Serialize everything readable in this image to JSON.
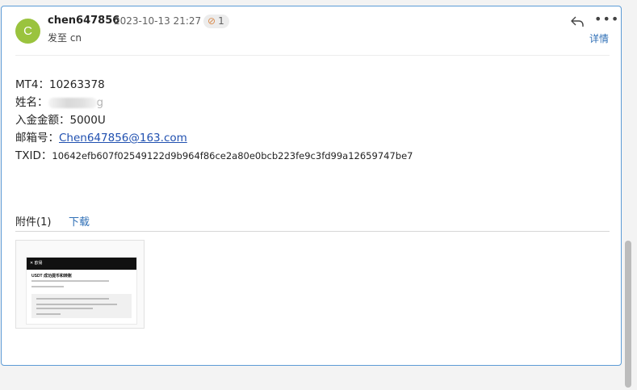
{
  "message": {
    "sender_initial": "C",
    "sender": "chen647856",
    "datetime": "2023-10-13 21:27",
    "attachment_count": "1",
    "to_line": "发至 cn",
    "details_label": "详情",
    "more_label": "•••"
  },
  "body": {
    "mt4_label": "MT4：",
    "mt4_value": "10263378",
    "name_label": "姓名：",
    "name_tail": "g",
    "deposit_label": "入金金额：",
    "deposit_value": "5000U",
    "email_label": "邮箱号：",
    "email_value": "Chen647856@163.com",
    "txid_label": "TXID：",
    "txid_value": "10642efb607f02549122d9b964f86ce2a80e0bcb223fe9c3fd99a12659747be7"
  },
  "attachments": {
    "header": "附件(1)",
    "download_label": "下载",
    "thumbnail": {
      "logo": "✕ 欧易",
      "title": "USDT 成功提币和转账"
    }
  },
  "colors": {
    "avatar": "#9ac33e",
    "link": "#2f6fb6",
    "border": "#5c9bd6"
  }
}
